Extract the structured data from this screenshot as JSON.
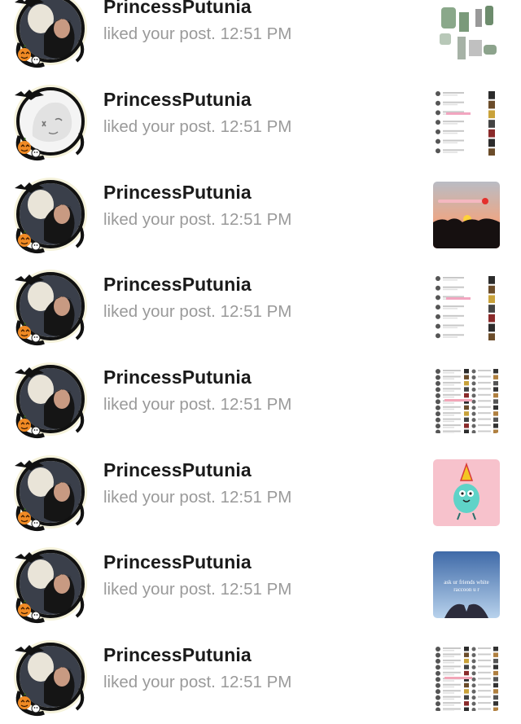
{
  "notifications": [
    {
      "username": "PrincessPutunia",
      "action": "liked your post.",
      "time": "12:51 PM",
      "avatar": "ghost-portrait-avatar",
      "thumbnail": "outfit-collage"
    },
    {
      "username": "PrincessPutunia",
      "action": "liked your post.",
      "time": "12:51 PM",
      "avatar": "white-ghost-avatar",
      "thumbnail": "comment-list-screenshot"
    },
    {
      "username": "PrincessPutunia",
      "action": "liked your post.",
      "time": "12:51 PM",
      "avatar": "ghost-portrait-avatar",
      "thumbnail": "sunset-photo"
    },
    {
      "username": "PrincessPutunia",
      "action": "liked your post.",
      "time": "12:51 PM",
      "avatar": "ghost-portrait-avatar",
      "thumbnail": "comment-list-screenshot"
    },
    {
      "username": "PrincessPutunia",
      "action": "liked your post.",
      "time": "12:51 PM",
      "avatar": "ghost-portrait-avatar",
      "thumbnail": "dense-comment-screenshot"
    },
    {
      "username": "PrincessPutunia",
      "action": "liked your post.",
      "time": "12:51 PM",
      "avatar": "ghost-portrait-avatar",
      "thumbnail": "party-bird-sticker"
    },
    {
      "username": "PrincessPutunia",
      "action": "liked your post.",
      "time": "12:51 PM",
      "avatar": "ghost-portrait-avatar",
      "thumbnail": "sky-hands-photo",
      "thumbnail_text": "ask ur friends white raccoon u r"
    },
    {
      "username": "PrincessPutunia",
      "action": "liked your post.",
      "time": "12:51 PM",
      "avatar": "ghost-portrait-avatar",
      "thumbnail": "dense-comment-screenshot"
    }
  ],
  "colors": {
    "username": "#1a1a1a",
    "secondary_text": "#9a9a9a",
    "background": "#ffffff"
  }
}
